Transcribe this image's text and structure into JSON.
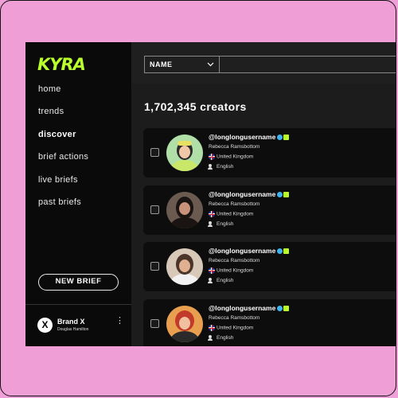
{
  "app": {
    "logo": "KYRA"
  },
  "sidebar": {
    "items": [
      {
        "label": "home",
        "active": false
      },
      {
        "label": "trends",
        "active": false
      },
      {
        "label": "discover",
        "active": true
      },
      {
        "label": "brief actions",
        "active": false
      },
      {
        "label": "live briefs",
        "active": false
      },
      {
        "label": "past briefs",
        "active": false
      }
    ],
    "new_brief_label": "NEW BRIEF",
    "brand": {
      "avatar_letter": "X",
      "name": "Brand X",
      "user": "Douglas Hamilton"
    }
  },
  "toolbar": {
    "filter_label": "NAME"
  },
  "main": {
    "count_label": "1,702,345 creators",
    "creators": [
      {
        "username": "@longlongusername",
        "name": "Rebecca Ramsbottom",
        "country": "United Kingdom",
        "language": "English",
        "palette": [
          "#c9e86a",
          "#2a2a2a",
          "#f0c8a8"
        ]
      },
      {
        "username": "@longlongusername",
        "name": "Rebecca Ramsbottom",
        "country": "United Kingdom",
        "language": "English",
        "palette": [
          "#6b5a50",
          "#1a1412",
          "#c9927a"
        ]
      },
      {
        "username": "@longlongusername",
        "name": "Rebecca Ramsbottom",
        "country": "United Kingdom",
        "language": "English",
        "palette": [
          "#d8c8b8",
          "#4a3528",
          "#e0b090"
        ]
      },
      {
        "username": "@longlongusername",
        "name": "Rebecca Ramsbottom",
        "country": "United Kingdom",
        "language": "English",
        "palette": [
          "#e8a050",
          "#c23a2a",
          "#f0c0a0"
        ]
      }
    ]
  },
  "colors": {
    "accent": "#b8ff2b",
    "background": "#ef9fd6",
    "verified": "#3db4f2"
  }
}
